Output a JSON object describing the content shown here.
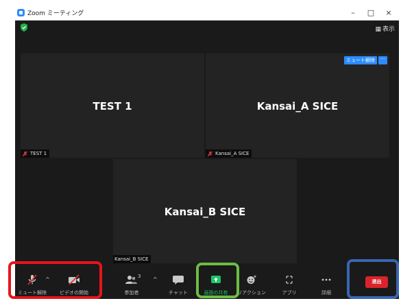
{
  "window": {
    "title": "Zoom ミーティング",
    "controls": {
      "minimize": "–",
      "maximize": "□",
      "close": "×"
    }
  },
  "topbar": {
    "view_icon": "grid-icon",
    "view_label": "表示",
    "encryption_icon": "green-shield-icon"
  },
  "participants": [
    {
      "name": "TEST 1",
      "label": "TEST 1",
      "muted": true
    },
    {
      "name": "Kansai_A SICE",
      "label": "Kansai_A SICE",
      "muted": true,
      "unmute_badge": "ミュート解除",
      "more_badge": "···"
    },
    {
      "name": "Kansai_B SICE",
      "label": "Kansai_B SICE",
      "muted": false
    }
  ],
  "toolbar": {
    "unmute_label": "ミュート解除",
    "video_label": "ビデオの開始",
    "participants_label": "参加者",
    "participants_count": "3",
    "chat_label": "チャット",
    "share_label": "画面の共有",
    "reactions_label": "リアクション",
    "apps_label": "アプリ",
    "more_label": "詳細",
    "leave_label": "退出",
    "caret": "^"
  },
  "colors": {
    "accent": "#2d8cff",
    "share_green": "#1cc46a",
    "leave_red": "#d9242b",
    "highlight_red": "#e8131b",
    "highlight_green": "#6cbd45",
    "highlight_blue": "#3a66b3"
  }
}
